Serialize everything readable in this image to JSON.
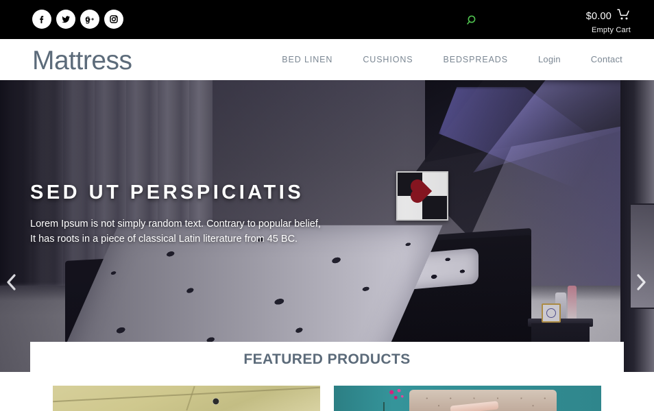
{
  "topbar": {
    "social": [
      {
        "name": "facebook-icon",
        "label": "Facebook"
      },
      {
        "name": "twitter-icon",
        "label": "Twitter"
      },
      {
        "name": "googleplus-icon",
        "label": "Google Plus"
      },
      {
        "name": "instagram-icon",
        "label": "Instagram"
      }
    ],
    "search_icon": "search-icon",
    "search_color": "#4fc24f",
    "cart": {
      "price": "$0.00",
      "status": "Empty Cart",
      "icon": "shopping-cart-icon"
    }
  },
  "header": {
    "logo": "Mattress",
    "logo_color": "#5c6b7a",
    "nav": [
      {
        "label": "BED LINEN",
        "style": "caps"
      },
      {
        "label": "CUSHIONS",
        "style": "caps"
      },
      {
        "label": "BEDSPREADS",
        "style": "caps"
      },
      {
        "label": "Login",
        "style": "plain"
      },
      {
        "label": "Contact",
        "style": "plain"
      }
    ]
  },
  "hero": {
    "title": "SED UT PERSPICIATIS",
    "text": "Lorem Ipsum is not simply random text. Contrary to popular belief, It has roots in a piece of classical Latin literature from 45 BC.",
    "prev_icon": "chevron-left-icon",
    "next_icon": "chevron-right-icon",
    "image_alt": "Dark bedroom with black bed frame, black-and-white floral bedspread and purple LED accent lighting"
  },
  "featured": {
    "title": "FEATURED PRODUCTS",
    "title_color": "#5c6b7a",
    "products": [
      {
        "name": "product-card-1",
        "alt": "Khaki ceiling panel with round light fixture"
      },
      {
        "name": "product-card-2",
        "alt": "Teal wall with tufted beige headboard and pink orchid"
      }
    ]
  }
}
